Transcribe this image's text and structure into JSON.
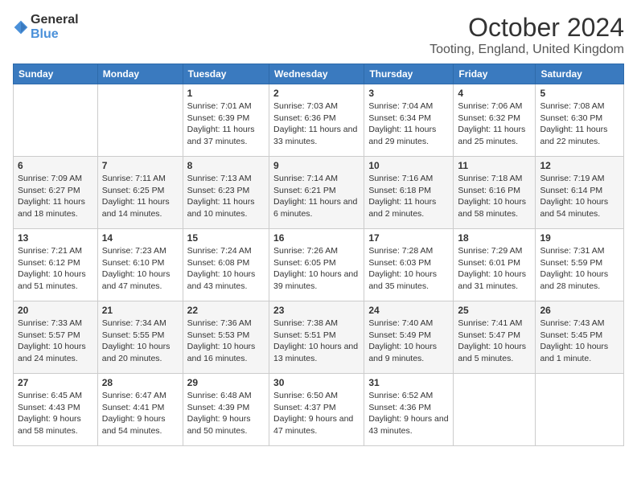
{
  "logo": {
    "general": "General",
    "blue": "Blue"
  },
  "title": "October 2024",
  "subtitle": "Tooting, England, United Kingdom",
  "days_of_week": [
    "Sunday",
    "Monday",
    "Tuesday",
    "Wednesday",
    "Thursday",
    "Friday",
    "Saturday"
  ],
  "weeks": [
    [
      {
        "day": "",
        "info": ""
      },
      {
        "day": "",
        "info": ""
      },
      {
        "day": "1",
        "info": "Sunrise: 7:01 AM\nSunset: 6:39 PM\nDaylight: 11 hours and 37 minutes."
      },
      {
        "day": "2",
        "info": "Sunrise: 7:03 AM\nSunset: 6:36 PM\nDaylight: 11 hours and 33 minutes."
      },
      {
        "day": "3",
        "info": "Sunrise: 7:04 AM\nSunset: 6:34 PM\nDaylight: 11 hours and 29 minutes."
      },
      {
        "day": "4",
        "info": "Sunrise: 7:06 AM\nSunset: 6:32 PM\nDaylight: 11 hours and 25 minutes."
      },
      {
        "day": "5",
        "info": "Sunrise: 7:08 AM\nSunset: 6:30 PM\nDaylight: 11 hours and 22 minutes."
      }
    ],
    [
      {
        "day": "6",
        "info": "Sunrise: 7:09 AM\nSunset: 6:27 PM\nDaylight: 11 hours and 18 minutes."
      },
      {
        "day": "7",
        "info": "Sunrise: 7:11 AM\nSunset: 6:25 PM\nDaylight: 11 hours and 14 minutes."
      },
      {
        "day": "8",
        "info": "Sunrise: 7:13 AM\nSunset: 6:23 PM\nDaylight: 11 hours and 10 minutes."
      },
      {
        "day": "9",
        "info": "Sunrise: 7:14 AM\nSunset: 6:21 PM\nDaylight: 11 hours and 6 minutes."
      },
      {
        "day": "10",
        "info": "Sunrise: 7:16 AM\nSunset: 6:18 PM\nDaylight: 11 hours and 2 minutes."
      },
      {
        "day": "11",
        "info": "Sunrise: 7:18 AM\nSunset: 6:16 PM\nDaylight: 10 hours and 58 minutes."
      },
      {
        "day": "12",
        "info": "Sunrise: 7:19 AM\nSunset: 6:14 PM\nDaylight: 10 hours and 54 minutes."
      }
    ],
    [
      {
        "day": "13",
        "info": "Sunrise: 7:21 AM\nSunset: 6:12 PM\nDaylight: 10 hours and 51 minutes."
      },
      {
        "day": "14",
        "info": "Sunrise: 7:23 AM\nSunset: 6:10 PM\nDaylight: 10 hours and 47 minutes."
      },
      {
        "day": "15",
        "info": "Sunrise: 7:24 AM\nSunset: 6:08 PM\nDaylight: 10 hours and 43 minutes."
      },
      {
        "day": "16",
        "info": "Sunrise: 7:26 AM\nSunset: 6:05 PM\nDaylight: 10 hours and 39 minutes."
      },
      {
        "day": "17",
        "info": "Sunrise: 7:28 AM\nSunset: 6:03 PM\nDaylight: 10 hours and 35 minutes."
      },
      {
        "day": "18",
        "info": "Sunrise: 7:29 AM\nSunset: 6:01 PM\nDaylight: 10 hours and 31 minutes."
      },
      {
        "day": "19",
        "info": "Sunrise: 7:31 AM\nSunset: 5:59 PM\nDaylight: 10 hours and 28 minutes."
      }
    ],
    [
      {
        "day": "20",
        "info": "Sunrise: 7:33 AM\nSunset: 5:57 PM\nDaylight: 10 hours and 24 minutes."
      },
      {
        "day": "21",
        "info": "Sunrise: 7:34 AM\nSunset: 5:55 PM\nDaylight: 10 hours and 20 minutes."
      },
      {
        "day": "22",
        "info": "Sunrise: 7:36 AM\nSunset: 5:53 PM\nDaylight: 10 hours and 16 minutes."
      },
      {
        "day": "23",
        "info": "Sunrise: 7:38 AM\nSunset: 5:51 PM\nDaylight: 10 hours and 13 minutes."
      },
      {
        "day": "24",
        "info": "Sunrise: 7:40 AM\nSunset: 5:49 PM\nDaylight: 10 hours and 9 minutes."
      },
      {
        "day": "25",
        "info": "Sunrise: 7:41 AM\nSunset: 5:47 PM\nDaylight: 10 hours and 5 minutes."
      },
      {
        "day": "26",
        "info": "Sunrise: 7:43 AM\nSunset: 5:45 PM\nDaylight: 10 hours and 1 minute."
      }
    ],
    [
      {
        "day": "27",
        "info": "Sunrise: 6:45 AM\nSunset: 4:43 PM\nDaylight: 9 hours and 58 minutes."
      },
      {
        "day": "28",
        "info": "Sunrise: 6:47 AM\nSunset: 4:41 PM\nDaylight: 9 hours and 54 minutes."
      },
      {
        "day": "29",
        "info": "Sunrise: 6:48 AM\nSunset: 4:39 PM\nDaylight: 9 hours and 50 minutes."
      },
      {
        "day": "30",
        "info": "Sunrise: 6:50 AM\nSunset: 4:37 PM\nDaylight: 9 hours and 47 minutes."
      },
      {
        "day": "31",
        "info": "Sunrise: 6:52 AM\nSunset: 4:36 PM\nDaylight: 9 hours and 43 minutes."
      },
      {
        "day": "",
        "info": ""
      },
      {
        "day": "",
        "info": ""
      }
    ]
  ]
}
